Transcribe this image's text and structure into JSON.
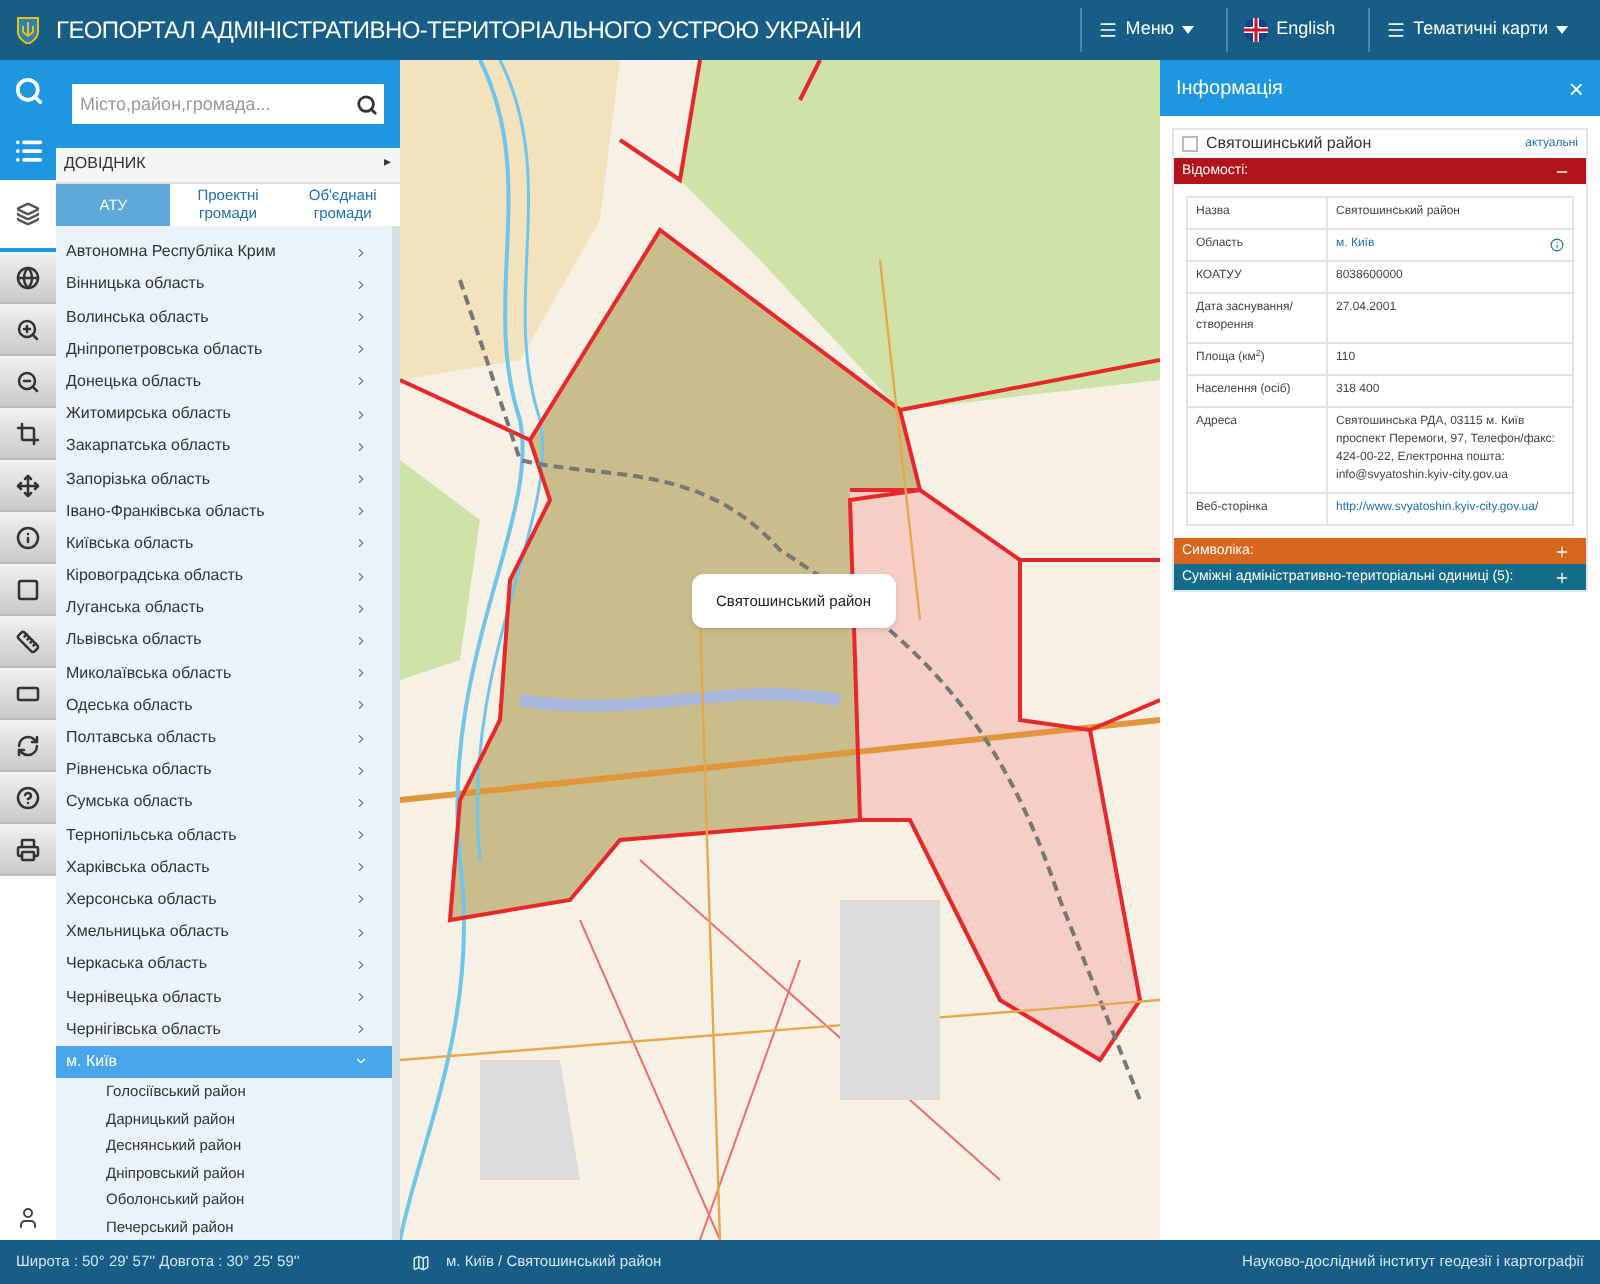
{
  "header": {
    "title": "ГЕОПОРТАЛ АДМІНІСТРАТИВНО-ТЕРИТОРІАЛЬНОГО УСТРОЮ УКРАЇНИ",
    "menus": [
      {
        "label": "Меню",
        "kind": "dropdown"
      },
      {
        "label": "English",
        "kind": "language"
      },
      {
        "label": "Тематичні карти",
        "kind": "dropdown"
      }
    ]
  },
  "toolbar": {
    "top": [
      {
        "selected": false
      },
      {
        "selected": false
      }
    ],
    "tools": [
      {
        "selected": true
      },
      {
        "selected": false
      },
      {
        "selected": false
      },
      {
        "selected": false
      },
      {
        "selected": false
      },
      {
        "selected": false
      },
      {
        "selected": false
      },
      {
        "selected": false
      },
      {
        "selected": false
      },
      {
        "selected": false
      },
      {
        "selected": false
      },
      {
        "selected": false
      },
      {
        "selected": false
      }
    ]
  },
  "search": {
    "placeholder": "Місто,район,громада..."
  },
  "directory": {
    "title": "ДОВІДНИК",
    "toggle": "▸"
  },
  "tabs": [
    {
      "label": "АТУ",
      "selected": true
    },
    {
      "label": "Проектні громади",
      "selected": false
    },
    {
      "label": "Об'єднані громади",
      "selected": false
    }
  ],
  "regions": [
    {
      "name": "Автономна Республіка Крим",
      "selected": false,
      "expanded": false
    },
    {
      "name": "Вінницька область",
      "selected": false,
      "expanded": false
    },
    {
      "name": "Волинська область",
      "selected": false,
      "expanded": false
    },
    {
      "name": "Дніпропетровська область",
      "selected": false,
      "expanded": false
    },
    {
      "name": "Донецька область",
      "selected": false,
      "expanded": false
    },
    {
      "name": "Житомирська область",
      "selected": false,
      "expanded": false
    },
    {
      "name": "Закарпатська область",
      "selected": false,
      "expanded": false
    },
    {
      "name": "Запорізька область",
      "selected": false,
      "expanded": false
    },
    {
      "name": "Івано-Франківська область",
      "selected": false,
      "expanded": false
    },
    {
      "name": "Київська область",
      "selected": false,
      "expanded": false
    },
    {
      "name": "Кіровоградська область",
      "selected": false,
      "expanded": false
    },
    {
      "name": "Луганська область",
      "selected": false,
      "expanded": false
    },
    {
      "name": "Львівська область",
      "selected": false,
      "expanded": false
    },
    {
      "name": "Миколаївська область",
      "selected": false,
      "expanded": false
    },
    {
      "name": "Одеська область",
      "selected": false,
      "expanded": false
    },
    {
      "name": "Полтавська область",
      "selected": false,
      "expanded": false
    },
    {
      "name": "Рівненська область",
      "selected": false,
      "expanded": false
    },
    {
      "name": "Сумська область",
      "selected": false,
      "expanded": false
    },
    {
      "name": "Тернопільська область",
      "selected": false,
      "expanded": false
    },
    {
      "name": "Харківська область",
      "selected": false,
      "expanded": false
    },
    {
      "name": "Херсонська область",
      "selected": false,
      "expanded": false
    },
    {
      "name": "Хмельницька область",
      "selected": false,
      "expanded": false
    },
    {
      "name": "Черкаська область",
      "selected": false,
      "expanded": false
    },
    {
      "name": "Чернівецька область",
      "selected": false,
      "expanded": false
    },
    {
      "name": "Чернігівська область",
      "selected": false,
      "expanded": false
    },
    {
      "name": "м. Київ",
      "selected": true,
      "expanded": true,
      "children": [
        {
          "name": "Голосіївський район"
        },
        {
          "name": "Дарницький район"
        },
        {
          "name": "Деснянський район"
        },
        {
          "name": "Дніпровський район"
        },
        {
          "name": "Оболонський район"
        },
        {
          "name": "Печерський район"
        }
      ]
    }
  ],
  "map": {
    "popup": "Святошинський район"
  },
  "info": {
    "title": "Інформація",
    "close": "×",
    "name": "Святошинський район",
    "checked": false,
    "status": "актуальні",
    "sections": [
      {
        "title": "Відомості:",
        "expanded": true,
        "color": "#b3131b"
      },
      {
        "title": "Символіка:",
        "expanded": false,
        "color": "#d9661f"
      },
      {
        "title": "Суміжні адміністративно-територіальні одиниці (5):",
        "expanded": false,
        "color": "#156b8a"
      }
    ],
    "rows": [
      {
        "label": "Назва",
        "value": "Святошинський район",
        "kind": "text"
      },
      {
        "label": "Область",
        "value": "м. Київ",
        "kind": "link-info"
      },
      {
        "label": "КОАТУУ",
        "value": "8038600000",
        "kind": "text"
      },
      {
        "label": "Дата заснування/ створення",
        "value": "27.04.2001",
        "kind": "text"
      },
      {
        "label": "Площа (км$^{2}$)",
        "value": "110",
        "kind": "text"
      },
      {
        "label": "Населення (осіб)",
        "value": "318 400",
        "kind": "text"
      },
      {
        "label": "Адреса",
        "value": "Святошинська РДА, 03115 м. Київ проспект Перемоги, 97, Телефон/факс: 424-00-22, Електронна пошта: info@svyatoshin.kyiv-city.gov.ua",
        "kind": "text"
      },
      {
        "label": "Веб-сторінка",
        "value": "http://www.svyatoshin.kyiv-city.gov.ua/",
        "kind": "link"
      }
    ]
  },
  "status_bar": {
    "coordinates": "Широта : 50° 29' 57'' Довгота : 30° 25' 59''",
    "path": "м. Київ / Святошинський район",
    "credit": "Науково-дослідний інститут геодезії і картографії"
  }
}
